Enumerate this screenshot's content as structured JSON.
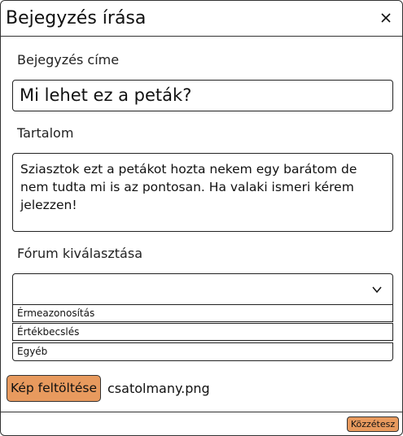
{
  "dialog": {
    "title": "Bejegyzés írása",
    "close_icon": "close-icon"
  },
  "form": {
    "title_label": "Bejegyzés címe",
    "title_value": "Mi lehet ez a peták?",
    "content_label": "Tartalom",
    "content_value": "Sziasztok ezt a petákot hozta nekem egy barátom de nem tudta mi is az pontosan. Ha valaki ismeri kérem jelezzen!",
    "forum_label": "Fórum kiválasztása",
    "forum_selected": "",
    "forum_options": [
      "Érmeazonosítás",
      "Értékbecslés",
      "Egyéb"
    ],
    "dropdown_icon": "chevron-down-icon"
  },
  "upload": {
    "button_label": "Kép feltöltése",
    "filename": "csatolmany.png"
  },
  "footer": {
    "publish_label": "Közzétesz"
  },
  "colors": {
    "accent": "#e89a5e",
    "border": "#333333"
  }
}
